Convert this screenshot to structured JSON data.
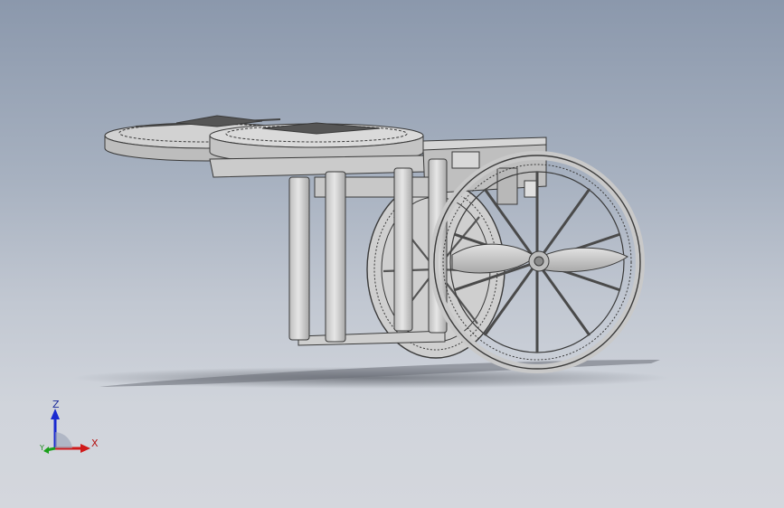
{
  "viewport": {
    "background_top": "#8b98ac",
    "background_bottom": "#d4d7dd",
    "model_fill": "#d4d4d4",
    "model_edge": "#3a3a3a"
  },
  "model": {
    "parts": [
      "rotor-disc-left",
      "rotor-disc-right",
      "support-columns",
      "gear-wheel-front",
      "gear-wheel-rear",
      "propeller"
    ]
  },
  "triad": {
    "z_label": "Z",
    "x_label": "X",
    "y_label": "Y",
    "z_color": "#1a2ad0",
    "x_color": "#d01a1a",
    "y_color": "#1aa01a"
  }
}
